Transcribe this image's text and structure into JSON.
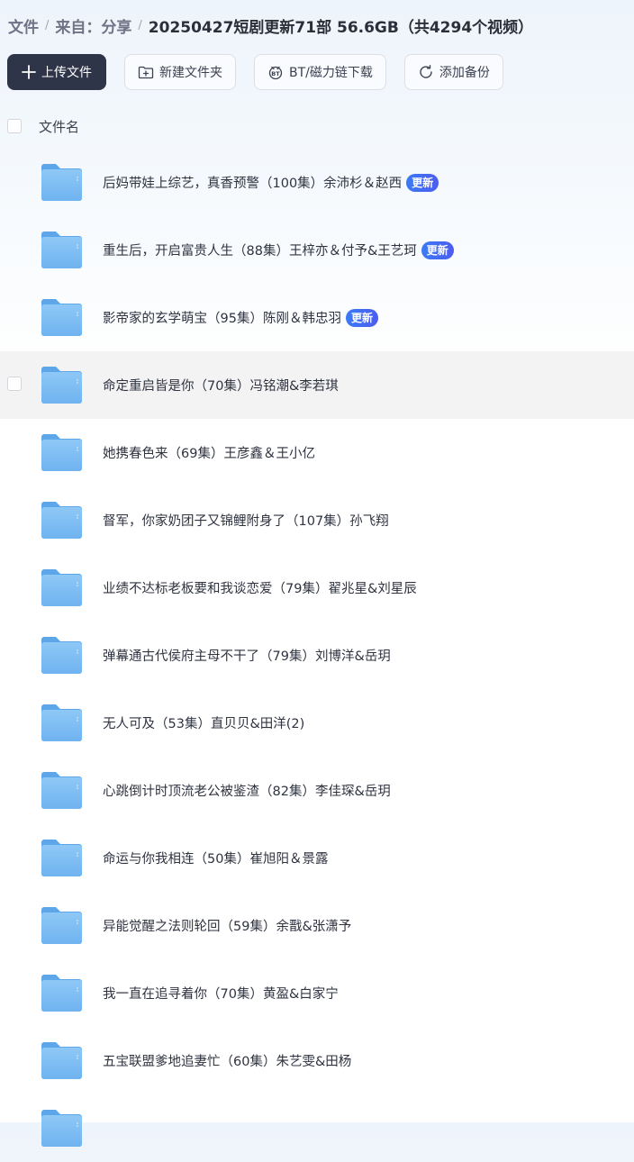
{
  "breadcrumb": {
    "root": "文件",
    "source": "来自：分享",
    "current": "20250427短剧更新71部 56.6GB（共4294个视频）"
  },
  "toolbar": {
    "upload_label": "上传文件",
    "new_folder_label": "新建文件夹",
    "bt_label": "BT/磁力链下载",
    "backup_label": "添加备份"
  },
  "header": {
    "filename_label": "文件名"
  },
  "badge_label": "更新",
  "files": [
    {
      "name": "后妈带娃上综艺，真香预警（100集）余沛杉＆赵西",
      "badge": "更新"
    },
    {
      "name": "重生后，开启富贵人生（88集）王梓亦＆付予&王艺珂",
      "badge": "更新"
    },
    {
      "name": "影帝家的玄学萌宝（95集）陈刚＆韩忠羽",
      "badge": "更新"
    },
    {
      "name": "命定重启皆是你（70集）冯铭潮&李若琪"
    },
    {
      "name": "她携春色来（69集）王彦鑫＆王小亿"
    },
    {
      "name": "督军，你家奶团子又锦鲤附身了（107集）孙飞翔"
    },
    {
      "name": "业绩不达标老板要和我谈恋爱（79集）翟兆星&刘星辰"
    },
    {
      "name": "弹幕通古代侯府主母不干了（79集）刘博洋&岳玥"
    },
    {
      "name": "无人可及（53集）直贝贝&田洋(2)"
    },
    {
      "name": "心跳倒计时顶流老公被鉴渣（82集）李佳琛&岳玥"
    },
    {
      "name": "命运与你我相连（50集）崔旭阳＆景露"
    },
    {
      "name": "异能觉醒之法则轮回（59集）余戬&张潇予"
    },
    {
      "name": "我一直在追寻着你（70集）黄盈&白家宁"
    },
    {
      "name": "五宝联盟爹地追妻忙（60集）朱艺雯&田杨"
    },
    {
      "name": ""
    }
  ],
  "colors": {
    "primary_button": "#2f3549",
    "badge": "#3b7bf5",
    "folder": "#7fbdf3",
    "hover_row": "#f3f3f3"
  }
}
